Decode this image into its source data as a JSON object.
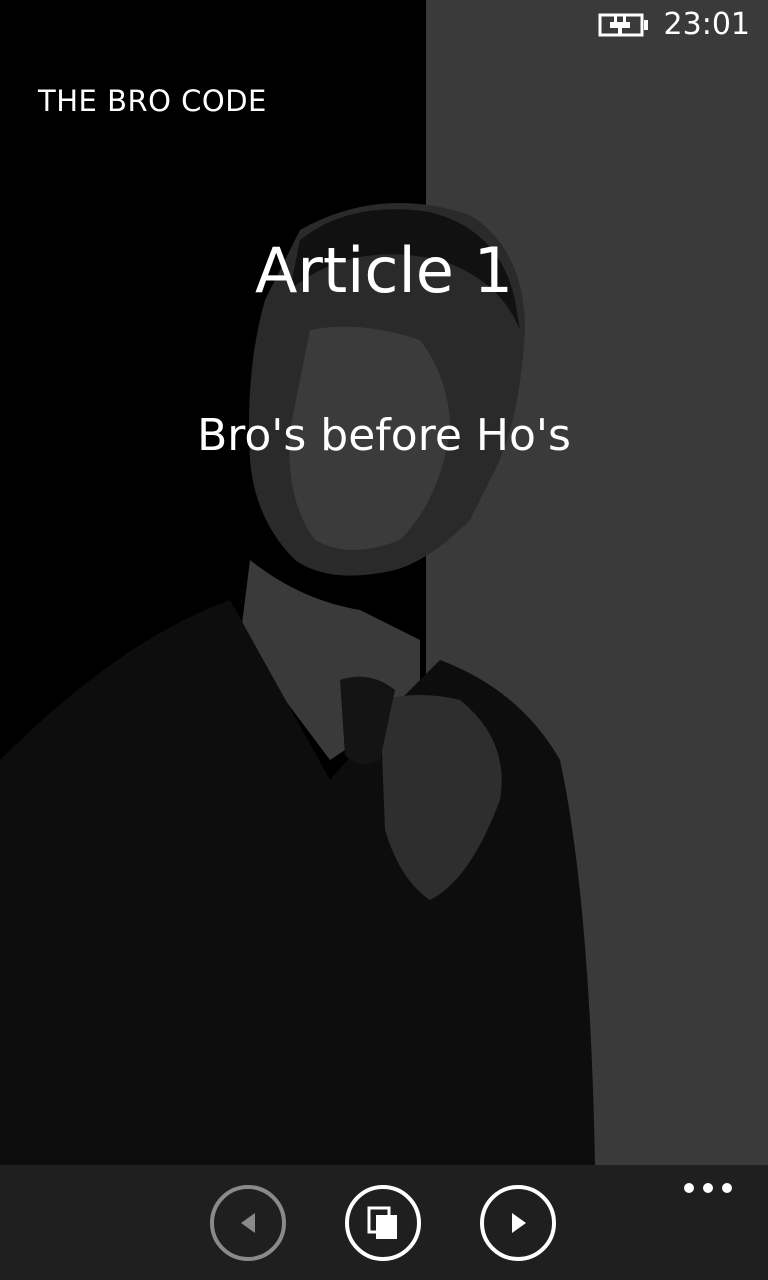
{
  "status": {
    "time": "23:01",
    "battery_icon": "battery-charging-icon"
  },
  "app": {
    "title": "THE BRO CODE"
  },
  "article": {
    "heading": "Article 1",
    "text": "Bro's before Ho's"
  },
  "appbar": {
    "buttons": [
      {
        "icon": "previous-icon",
        "enabled": false
      },
      {
        "icon": "copy-icon",
        "enabled": true
      },
      {
        "icon": "next-icon",
        "enabled": true
      }
    ],
    "more_icon": "ellipsis-icon"
  },
  "colors": {
    "background": "#000000",
    "panel": "#3a3a3a",
    "appbar": "#1f1f1f",
    "text": "#ffffff"
  }
}
